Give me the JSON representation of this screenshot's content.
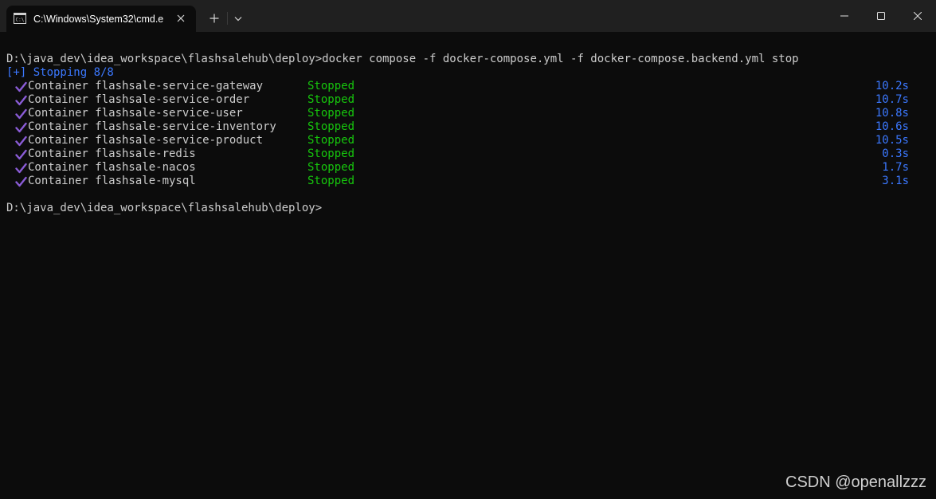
{
  "titlebar": {
    "tab_title": "C:\\Windows\\System32\\cmd.e",
    "tab_icon": "cmd-icon",
    "close_icon": "close-icon",
    "new_tab_icon": "plus-icon",
    "dropdown_icon": "chevron-down-icon",
    "minimize_icon": "minimize-icon",
    "maximize_icon": "maximize-icon",
    "window_close_icon": "close-icon"
  },
  "terminal": {
    "command_line": "D:\\java_dev\\idea_workspace\\flashsalehub\\deploy>docker compose -f docker-compose.yml -f docker-compose.backend.yml stop",
    "progress_line": "[+] Stopping 8/8",
    "containers": [
      {
        "name": "Container flashsale-service-gateway",
        "status": "Stopped",
        "time": "10.2s"
      },
      {
        "name": "Container flashsale-service-order",
        "status": "Stopped",
        "time": "10.7s"
      },
      {
        "name": "Container flashsale-service-user",
        "status": "Stopped",
        "time": "10.8s"
      },
      {
        "name": "Container flashsale-service-inventory",
        "status": "Stopped",
        "time": "10.6s"
      },
      {
        "name": "Container flashsale-service-product",
        "status": "Stopped",
        "time": "10.5s"
      },
      {
        "name": "Container flashsale-redis",
        "status": "Stopped",
        "time": "0.3s"
      },
      {
        "name": "Container flashsale-nacos",
        "status": "Stopped",
        "time": "1.7s"
      },
      {
        "name": "Container flashsale-mysql",
        "status": "Stopped",
        "time": "3.1s"
      }
    ],
    "prompt": "D:\\java_dev\\idea_workspace\\flashsalehub\\deploy>",
    "check_icon": "checkmark-icon"
  },
  "colors": {
    "background": "#0c0c0c",
    "titlebar": "#202020",
    "text": "#cccccc",
    "stopped": "#16c60c",
    "blue": "#3b78ff",
    "check": "#8a5cd6"
  },
  "watermark": "CSDN @openallzzz"
}
